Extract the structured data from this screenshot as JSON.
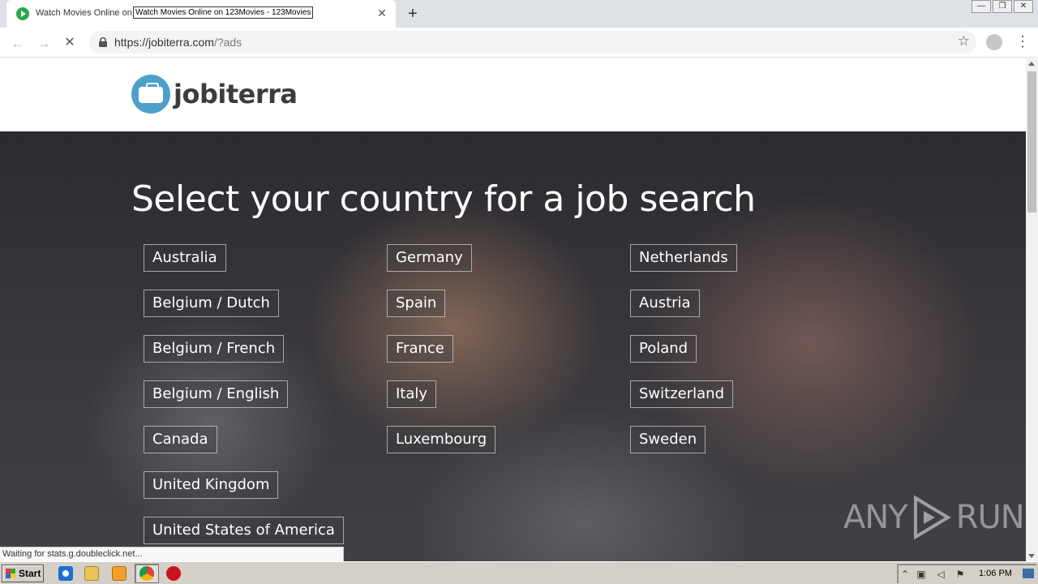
{
  "browser": {
    "tab": {
      "title": "Watch Movies Online on 123Movies - 123Movies.com",
      "tooltip": "Watch Movies Online on 123Movies - 123Movies",
      "close_glyph": "✕"
    },
    "newtab_glyph": "+",
    "window_controls": [
      "—",
      "❐",
      "✕"
    ],
    "nav": {
      "back": "←",
      "forward": "→",
      "stop": "✕"
    },
    "address": {
      "url_main": "https://jobiterra.com",
      "url_rest": "/?ads"
    },
    "star_glyph": "☆",
    "menu_glyph": "⋮"
  },
  "site": {
    "logo_text": "jobiterra",
    "hero_title": "Select your country for a job search",
    "countries": {
      "col1": [
        "Australia",
        "Belgium / Dutch",
        "Belgium / French",
        "Belgium / English",
        "Canada",
        "United Kingdom",
        "United States of America"
      ],
      "col2": [
        "Germany",
        "Spain",
        "France",
        "Italy",
        "Luxembourg"
      ],
      "col3": [
        "Netherlands",
        "Austria",
        "Poland",
        "Switzerland",
        "Sweden"
      ]
    },
    "watermark": {
      "left": "ANY",
      "right": "RUN"
    }
  },
  "status_text": "Waiting for stats.g.doubleclick.net...",
  "taskbar": {
    "start_label": "Start",
    "clock": "1:06 PM"
  },
  "colors": {
    "logo_accent": "#4e9fc9",
    "favicon": "#2aa84a"
  }
}
